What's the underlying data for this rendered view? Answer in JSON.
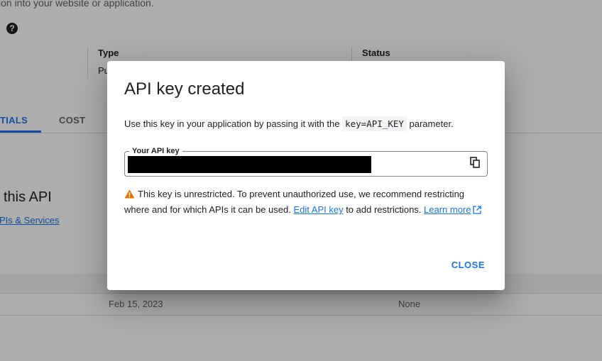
{
  "background": {
    "description_fragment": "ion into your website or application.",
    "help_icon": "help-circle-icon",
    "table_columns": [
      "Type",
      "Status"
    ],
    "type_value_fragment": "Pu",
    "tabs": [
      {
        "label": "TIALS",
        "active": true
      },
      {
        "label": "COST",
        "active": false
      }
    ],
    "section_title_fragment": "this API",
    "section_link_fragment": "PIs & Services",
    "row": {
      "date": "Feb 15, 2023",
      "status": "None"
    }
  },
  "dialog": {
    "title": "API key created",
    "description_before": "Use this key in your application by passing it with the ",
    "description_code": "key=API_KEY",
    "description_after": " parameter.",
    "field_label": "Your API key",
    "field_value": "",
    "copy_icon": "copy-icon",
    "warning_icon": "warning-triangle-icon",
    "warning_text": "This key is unrestricted. To prevent unauthorized use, we recommend restricting where and for which APIs it can be used.",
    "edit_link": "Edit API key",
    "after_edit": " to add restrictions.",
    "learn_more": "Learn more",
    "external_icon": "open-in-new-icon",
    "close_label": "CLOSE"
  },
  "colors": {
    "accent": "#1a73e8",
    "warning": "#e37400",
    "scrim": "rgba(0,0,0,0.32)"
  }
}
